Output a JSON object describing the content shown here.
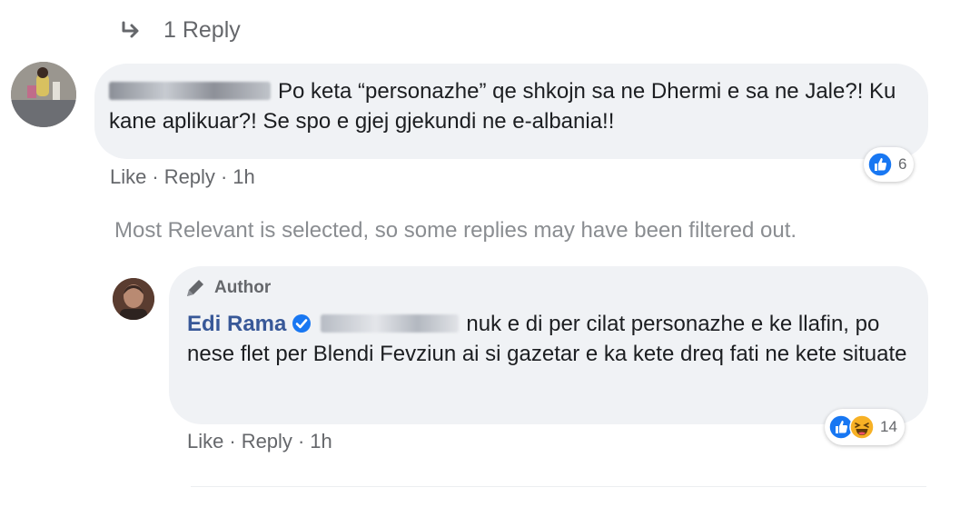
{
  "replies_toggle": {
    "label": "1 Reply"
  },
  "comment": {
    "author_name_blurred": "E.",
    "text": "Po keta “personazhe” qe shkojn sa ne Dhermi e sa ne Jale?! Ku kane aplikuar?! Se spo e gjej gjekundi ne e-albania!!",
    "actions": {
      "like": "Like",
      "reply": "Reply",
      "time": "1h",
      "separator": "·"
    },
    "reactions": {
      "count": "6",
      "icons": [
        "like-icon"
      ]
    }
  },
  "filter_notice": "Most Relevant is selected, so some replies may have been filtered out.",
  "reply": {
    "badge": {
      "label": "Author",
      "icon": "pen-icon"
    },
    "author_name": "Edi Rama",
    "verified_icon": "verified-icon",
    "text": "nuk e di per cilat personazhe e ke llafin, po nese flet per Blendi Fevziun ai si gazetar e ka kete dreq fati ne kete situate",
    "actions": {
      "like": "Like",
      "reply": "Reply",
      "time": "1h",
      "separator": "·"
    },
    "reactions": {
      "count": "14",
      "icons": [
        "like-icon",
        "haha-icon"
      ]
    }
  },
  "colors": {
    "link": "#385898",
    "muted": "#65676b",
    "bubble": "#f0f2f5",
    "like_blue": "#1877f2",
    "haha_yellow": "#f7b125"
  }
}
